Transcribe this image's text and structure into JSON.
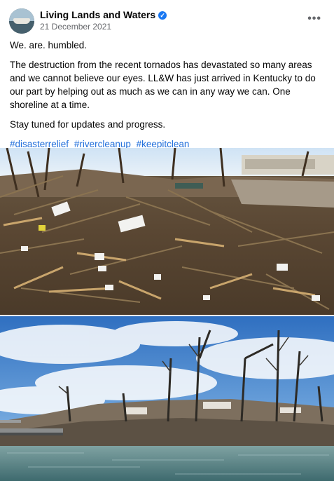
{
  "post": {
    "author": "Living Lands and Waters",
    "verified_badge": "✓",
    "date": "21 December 2021",
    "more_label": "•••",
    "paragraphs": [
      "We. are. humbled.",
      "The destruction from the recent tornados has devastated so many areas and we cannot believe our eyes. LL&W has just arrived in Kentucky to do our part by helping out as much as we can in any way we can. One shoreline at a time.",
      "Stay tuned for updates and progress."
    ],
    "hashtags": [
      "#disasterrelief",
      "#rivercleanup",
      "#keepitclean"
    ]
  },
  "icons": {
    "verified": "verified-badge-icon",
    "more": "more-options-icon"
  },
  "colors": {
    "link": "#216fdb",
    "verified": "#1877f2",
    "secondary_text": "#65676b"
  }
}
